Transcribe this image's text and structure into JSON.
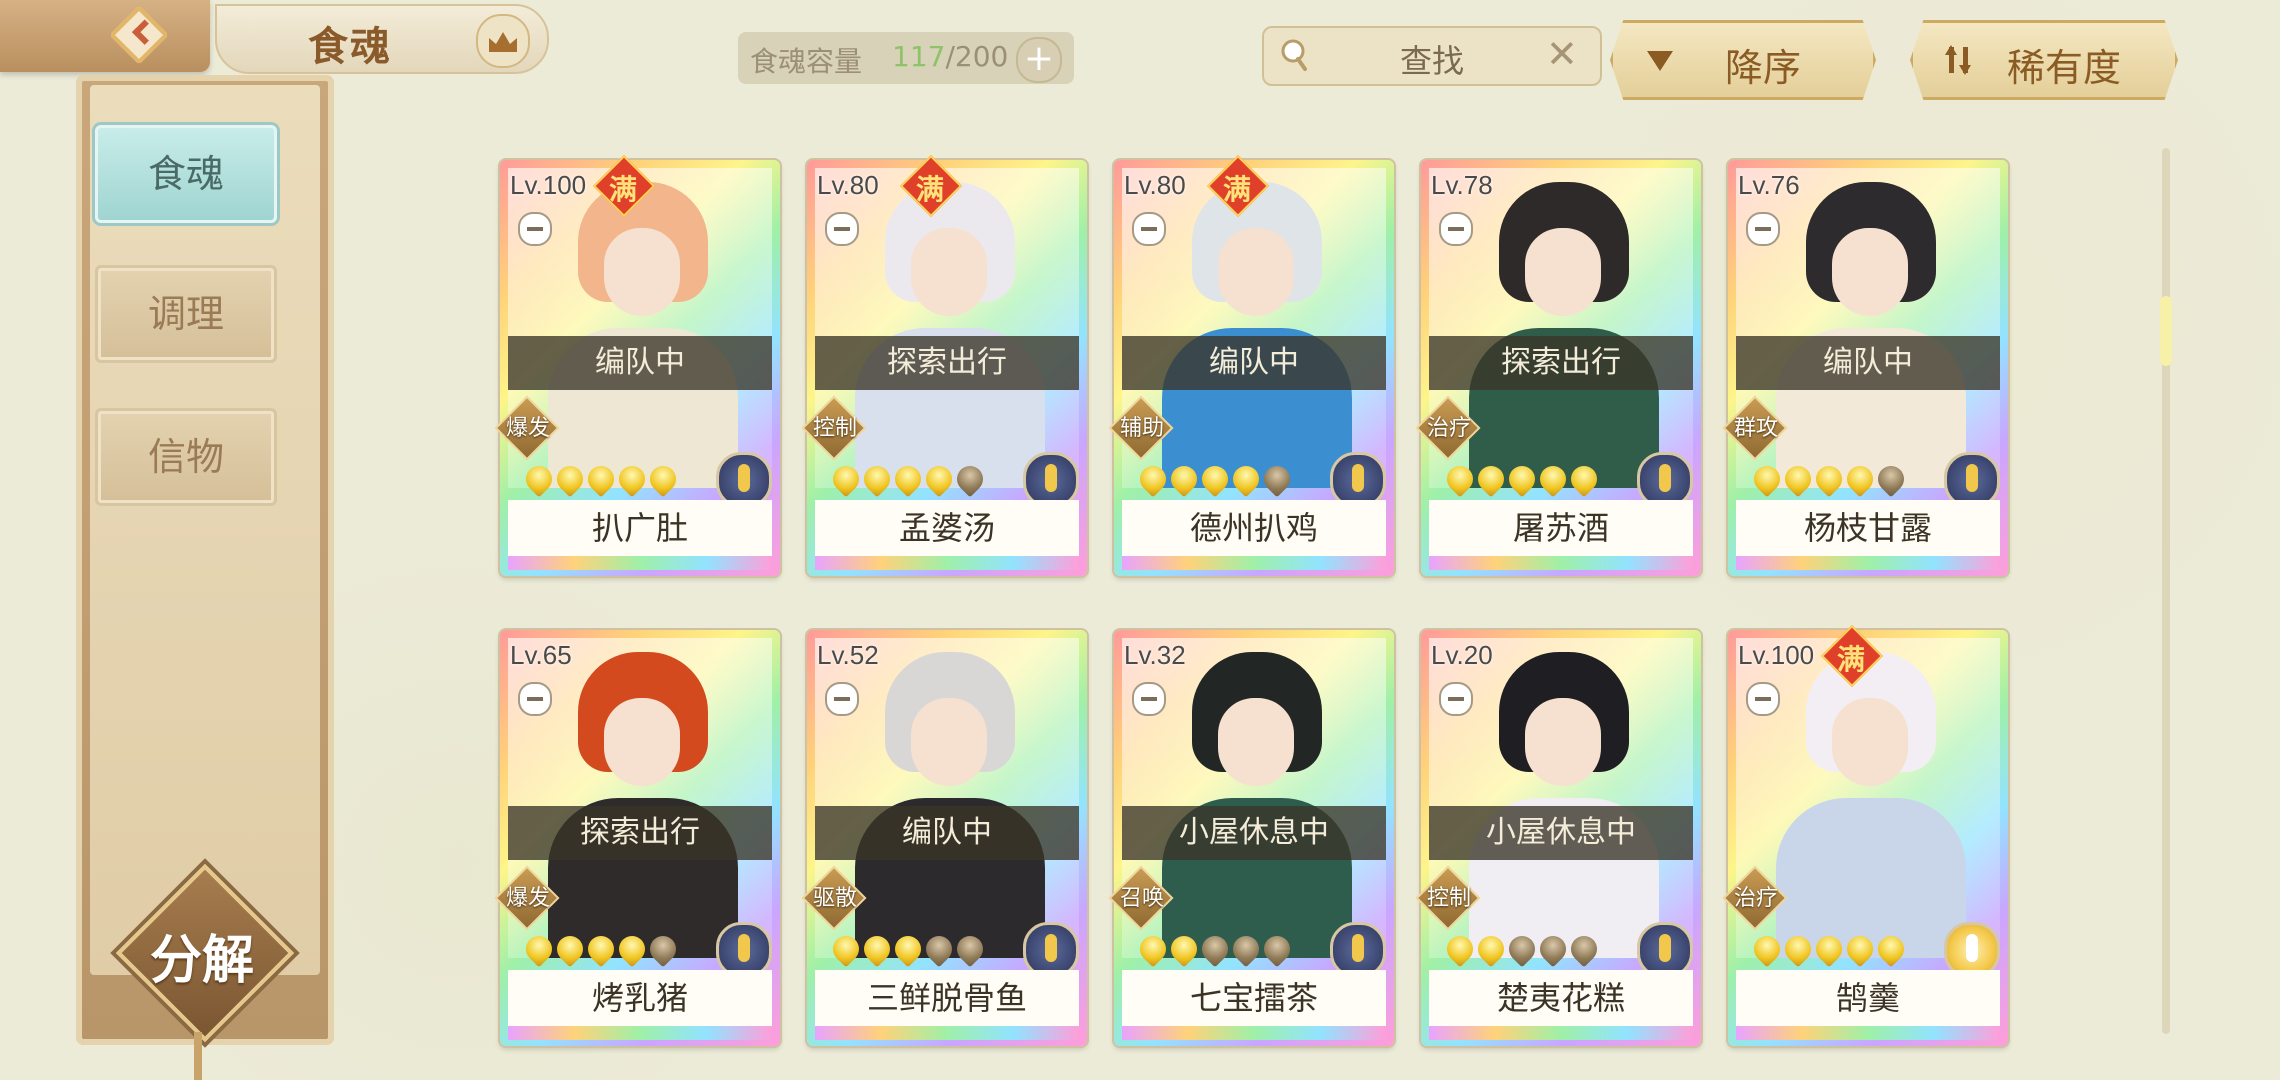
{
  "header": {
    "title": "食魂",
    "capacity_label": "食魂容量",
    "capacity_current": "117",
    "capacity_total": "/200",
    "search_placeholder": "查找",
    "sort_order_label": "降序",
    "sort_key_label": "稀有度"
  },
  "sidebar": {
    "tabs": [
      {
        "label": "食魂",
        "active": true
      },
      {
        "label": "调理",
        "active": false
      },
      {
        "label": "信物",
        "active": false
      }
    ],
    "decompose_label": "分解"
  },
  "cards": [
    {
      "level": "Lv.100",
      "max": true,
      "max_label": "满",
      "status": "编队中",
      "role": "爆发",
      "stars": 5,
      "name": "扒广肚",
      "hair": "#f2b58c",
      "body": "#ede7d4",
      "elem": "blue"
    },
    {
      "level": "Lv.80",
      "max": true,
      "max_label": "满",
      "status": "探索出行",
      "role": "控制",
      "stars": 4,
      "name": "孟婆汤",
      "hair": "#ece9ee",
      "body": "#d8e0ee",
      "elem": "blue"
    },
    {
      "level": "Lv.80",
      "max": true,
      "max_label": "满",
      "status": "编队中",
      "role": "辅助",
      "stars": 4,
      "name": "德州扒鸡",
      "hair": "#dfe4e8",
      "body": "#3b8fd1",
      "elem": "blue"
    },
    {
      "level": "Lv.78",
      "max": false,
      "max_label": "",
      "status": "探索出行",
      "role": "治疗",
      "stars": 5,
      "name": "屠苏酒",
      "hair": "#2e2a2a",
      "body": "#2f5d4a",
      "elem": "blue"
    },
    {
      "level": "Lv.76",
      "max": false,
      "max_label": "",
      "status": "编队中",
      "role": "群攻",
      "stars": 4,
      "name": "杨枝甘露",
      "hair": "#2d2b2e",
      "body": "#f2e9d8",
      "elem": "blue"
    },
    {
      "level": "Lv.65",
      "max": false,
      "max_label": "",
      "status": "探索出行",
      "role": "爆发",
      "stars": 4,
      "name": "烤乳猪",
      "hair": "#d34a1f",
      "body": "#2f2b2a",
      "elem": "blue"
    },
    {
      "level": "Lv.52",
      "max": false,
      "max_label": "",
      "status": "编队中",
      "role": "驱散",
      "stars": 3,
      "name": "三鲜脱骨鱼",
      "hair": "#d9d7d6",
      "body": "#2c2a2c",
      "elem": "blue"
    },
    {
      "level": "Lv.32",
      "max": false,
      "max_label": "",
      "status": "小屋休息中",
      "role": "召唤",
      "stars": 2,
      "name": "七宝擂茶",
      "hair": "#222625",
      "body": "#2e5d4e",
      "elem": "blue"
    },
    {
      "level": "Lv.20",
      "max": false,
      "max_label": "",
      "status": "小屋休息中",
      "role": "控制",
      "stars": 2,
      "name": "楚夷花糕",
      "hair": "#1f1e22",
      "body": "#f0eef2",
      "elem": "blue"
    },
    {
      "level": "Lv.100",
      "max": true,
      "max_label": "满",
      "status": "",
      "role": "治疗",
      "stars": 5,
      "name": "鹄羹",
      "hair": "#f3eef3",
      "body": "#c9d6ea",
      "elem": "gold"
    }
  ]
}
